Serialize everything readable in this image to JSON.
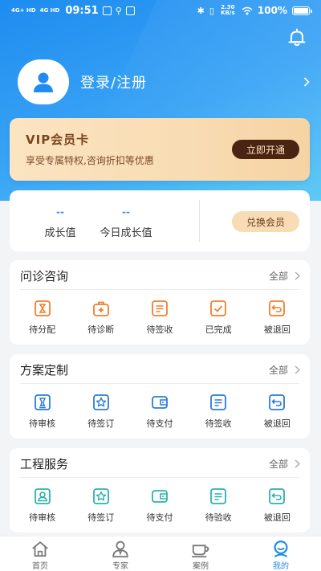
{
  "status_bar": {
    "signal_1": "4G+ HD",
    "signal_2": "4G HD",
    "time": "09:51",
    "net_speed": "2.30 KB/s",
    "battery": "100%"
  },
  "profile": {
    "login_label": "登录/注册"
  },
  "vip": {
    "title": "VIP会员卡",
    "description": "享受专属特权,咨询折扣等优惠",
    "button_label": "立即开通"
  },
  "stats": [
    {
      "value": "--",
      "label": "成长值"
    },
    {
      "value": "--",
      "label": "今日成长值"
    }
  ],
  "exchange_label": "兑换会员",
  "sections": [
    {
      "title": "问诊咨询",
      "all_label": "全部",
      "color": "#f07f2e",
      "items": [
        {
          "label": "待分配",
          "icon": "hourglass-icon"
        },
        {
          "label": "待诊断",
          "icon": "medical-kit-icon"
        },
        {
          "label": "待签收",
          "icon": "document-icon"
        },
        {
          "label": "已完成",
          "icon": "check-icon"
        },
        {
          "label": "被退回",
          "icon": "return-icon"
        }
      ]
    },
    {
      "title": "方案定制",
      "all_label": "全部",
      "color": "#2b7cd9",
      "items": [
        {
          "label": "待审核",
          "icon": "review-icon"
        },
        {
          "label": "待签订",
          "icon": "star-icon"
        },
        {
          "label": "待支付",
          "icon": "wallet-icon"
        },
        {
          "label": "待签收",
          "icon": "document-icon"
        },
        {
          "label": "被退回",
          "icon": "return-icon"
        }
      ]
    },
    {
      "title": "工程服务",
      "all_label": "全部",
      "color": "#2bb3a8",
      "items": [
        {
          "label": "待审核",
          "icon": "person-icon"
        },
        {
          "label": "待签订",
          "icon": "star-icon"
        },
        {
          "label": "待支付",
          "icon": "wallet-icon"
        },
        {
          "label": "待验收",
          "icon": "document-icon"
        },
        {
          "label": "被退回",
          "icon": "return-icon"
        }
      ]
    }
  ],
  "tabs": [
    {
      "label": "首页",
      "icon": "home-icon",
      "active": false
    },
    {
      "label": "专家",
      "icon": "expert-icon",
      "active": false
    },
    {
      "label": "案例",
      "icon": "cup-icon",
      "active": false
    },
    {
      "label": "我的",
      "icon": "mine-icon",
      "active": true
    }
  ],
  "colors": {
    "primary": "#1e8cf0",
    "vip_button": "#4a2412",
    "inactive_tab": "#7a7a7a"
  }
}
